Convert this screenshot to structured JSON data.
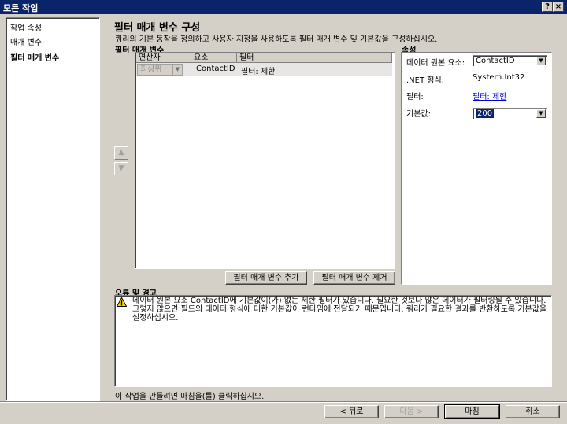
{
  "window": {
    "title": "모든 작업",
    "help_label": "?",
    "close_label": "×"
  },
  "nav": {
    "items": [
      {
        "label": "작업 속성"
      },
      {
        "label": "매개 변수"
      },
      {
        "label": "필터 매개 변수"
      }
    ]
  },
  "header": {
    "title": "필터 매개 변수 구성",
    "description": "쿼리의 기본 동작을 정의하고 사용자 지정을 사용하도록 필터 매개 변수 및 기본값을 구성하십시오."
  },
  "params": {
    "label": "필터 매개 변수",
    "columns": [
      "연산자",
      "요소",
      "필터"
    ],
    "rows": [
      {
        "operator": "최상위",
        "element": "ContactID",
        "filter": "필터: 제한"
      }
    ],
    "up_icon": "up-arrow-icon",
    "down_icon": "down-arrow-icon",
    "add_button": "필터 매개 변수 추가",
    "remove_button": "필터 매개 변수 제거"
  },
  "properties": {
    "label": "속성",
    "datasource_label": "데이터 원본 요소:",
    "datasource_value": "ContactID",
    "nettype_label": ".NET 형식:",
    "nettype_value": "System.Int32",
    "filter_label": "필터:",
    "filter_value": "필터: 제한",
    "default_label": "기본값:",
    "default_value": "200"
  },
  "errors": {
    "label": "오류 및 경고",
    "icon": "warning-icon",
    "message": "데이터 원본 요소 ContactID에 기본값이(가) 없는 제한 필터가 있습니다. 필요한 것보다 많은 데이터가 필터링될 수 있습니다. 그렇지 않으면 필드의 데이터 형식에 대한 기본값이 런타임에 전달되기 때문입니다. 쿼리가 필요한 결과를 반환하도록 기본값을 설정하십시오."
  },
  "status": "이 작업을 만들려면 마침을(를) 클릭하십시오.",
  "footer": {
    "back": "< 뒤로",
    "next": "다음 >",
    "finish": "마침",
    "cancel": "취소"
  }
}
